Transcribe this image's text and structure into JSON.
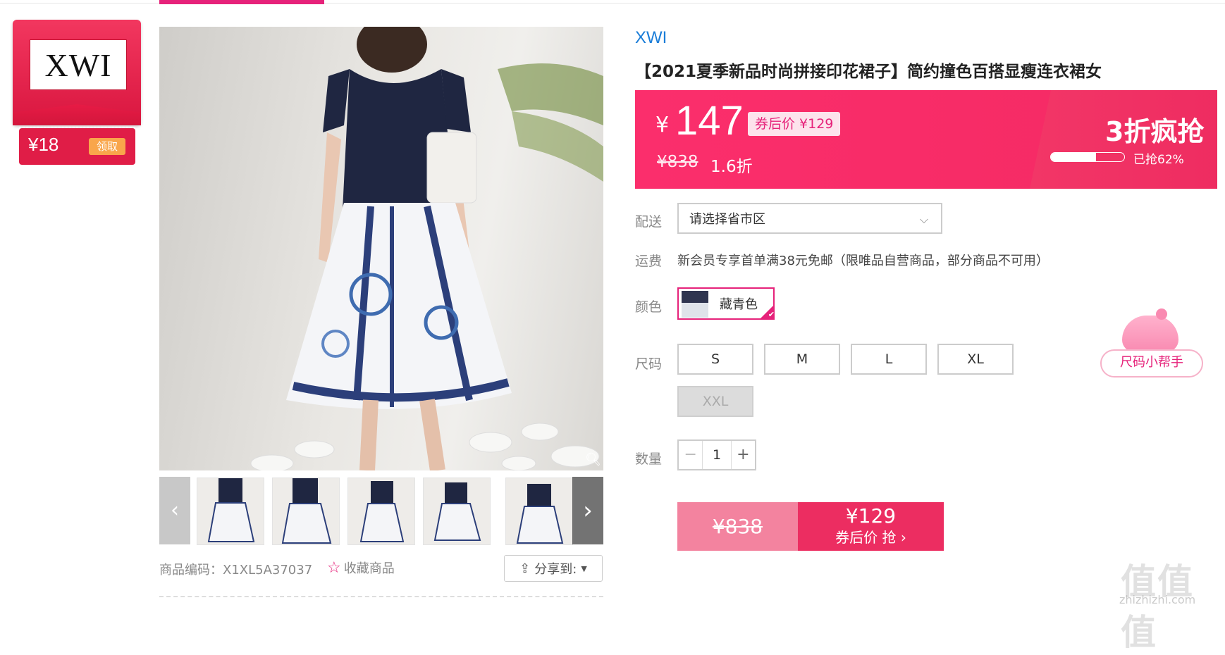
{
  "brand_badge": {
    "logo_text": "XWI",
    "coupon_amount": "¥18",
    "coupon_button": "领取"
  },
  "gallery": {
    "prev_arrow": "‹",
    "next_arrow": "›",
    "thumbnail_count": 6
  },
  "product_meta": {
    "sku_label": "商品编码：X1XL5A37037",
    "favorite_label": "收藏商品",
    "share_label": "分享到:"
  },
  "product": {
    "brand": "XWI",
    "title": "【2021夏季新品时尚拼接印花裙子】简约撞色百搭显瘦连衣裙女"
  },
  "price_banner": {
    "currency": "¥",
    "price": "147",
    "after_coupon": "券后价 ¥129",
    "original_price": "¥838",
    "discount": "1.6折",
    "promo_title": "3折疯抢",
    "sold_percent": 62,
    "sold_text": "已抢62%"
  },
  "delivery": {
    "label": "配送",
    "placeholder": "请选择省市区"
  },
  "shipping": {
    "label": "运费",
    "text": "新会员专享首单满38元免邮（限唯品自营商品，部分商品不可用）"
  },
  "color": {
    "label": "颜色",
    "selected": "藏青色"
  },
  "size": {
    "label": "尺码",
    "options": [
      "S",
      "M",
      "L",
      "XL",
      "XXL"
    ],
    "helper": "尺码小帮手"
  },
  "quantity": {
    "label": "数量",
    "value": "1",
    "minus": "−",
    "plus": "+"
  },
  "buy_button": {
    "original": "¥838",
    "price": "¥129",
    "text": "券后价 抢 ›"
  },
  "watermark": {
    "text": "值值值",
    "url": "zhizhizhi.com"
  },
  "colors": {
    "accent": "#e6227a",
    "banner": "#f42a63",
    "link_blue": "#1a7dd8"
  }
}
